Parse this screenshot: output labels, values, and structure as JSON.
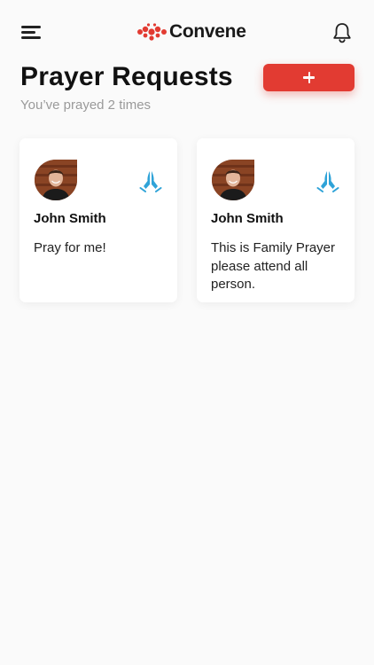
{
  "header": {
    "logo_text": "Convene"
  },
  "page": {
    "title": "Prayer Requests",
    "subtitle": "You’ve prayed 2 times"
  },
  "cards": [
    {
      "name": "John Smith",
      "text": "Pray for me!"
    },
    {
      "name": "John Smith",
      "text": "This is Family Prayer please attend all person."
    }
  ],
  "colors": {
    "accent": "#e23b32",
    "pray_icon": "#2fa3d8",
    "subtitle": "#9a9a9a",
    "background": "#fafafa"
  },
  "icons": {
    "menu": "menu-icon",
    "bell": "bell-icon",
    "add": "plus-icon",
    "pray": "praying-hands-icon"
  }
}
